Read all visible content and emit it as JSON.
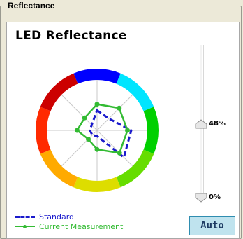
{
  "group": {
    "title": "Reflectance"
  },
  "panel": {
    "title": "LED Reflectance"
  },
  "radar": {
    "ring_colors": [
      "#0000ff",
      "#00e5ff",
      "#00d000",
      "#66dd00",
      "#dddd00",
      "#ffaa00",
      "#ff2a00",
      "#cc0000"
    ],
    "series": [
      {
        "key": "standard",
        "color": "#1a1acc",
        "style": "dashed",
        "values": [
          0.42,
          0.35,
          0.72,
          0.8,
          0.12,
          0.14,
          0.15,
          0.16
        ]
      },
      {
        "key": "current",
        "color": "#33bb33",
        "style": "solid",
        "values": [
          0.55,
          0.66,
          0.64,
          0.67,
          0.4,
          0.26,
          0.42,
          0.37
        ]
      }
    ]
  },
  "legend": {
    "standard": "Standard",
    "current": "Current Measurement"
  },
  "slider": {
    "upper_label": "48%",
    "upper_value": 0.48,
    "lower_label": "0%",
    "lower_value": 0.0
  },
  "auto_button": {
    "label": "Auto"
  }
}
